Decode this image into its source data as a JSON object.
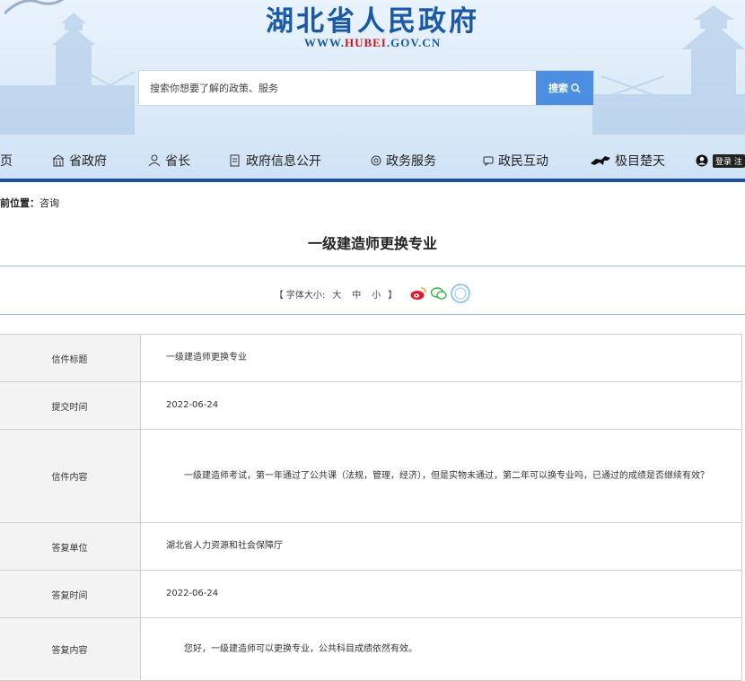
{
  "header": {
    "site_title": "湖北省人民政府",
    "site_url_prefix": "WWW.",
    "site_url_highlight": "HUBEI",
    "site_url_suffix": ".GOV.CN"
  },
  "search": {
    "placeholder": "搜索你想要了解的政策、服务",
    "button_label": "搜索"
  },
  "nav": {
    "items": [
      {
        "label": "页",
        "icon": "home-icon"
      },
      {
        "label": "省政府",
        "icon": "building-icon"
      },
      {
        "label": "省长",
        "icon": "person-icon"
      },
      {
        "label": "政府信息公开",
        "icon": "document-icon"
      },
      {
        "label": "政务服务",
        "icon": "service-icon"
      },
      {
        "label": "政民互动",
        "icon": "chat-icon"
      },
      {
        "label": "极目楚天",
        "icon": "horse-icon"
      }
    ],
    "login_label": "登录 注"
  },
  "breadcrumb": {
    "prefix": "前位置：",
    "current": "咨询"
  },
  "article": {
    "title": "一级建造师更换专业",
    "font_size_label": "【 字体大小:",
    "size_large": "大",
    "size_medium": "中",
    "size_small": "小",
    "font_size_end": "】"
  },
  "letter": {
    "rows": [
      {
        "label": "信件标题",
        "value": "一级建造师更换专业"
      },
      {
        "label": "提交时间",
        "value": "2022-06-24"
      },
      {
        "label": "信件内容",
        "value": "一级建造师考试，第一年通过了公共课（法规，管理，经济），但是实物未通过，第二年可以换专业吗，已通过的成绩是否继续有效？"
      },
      {
        "label": "答复单位",
        "value": "湖北省人力资源和社会保障厅"
      },
      {
        "label": "答复时间",
        "value": "2022-06-24"
      },
      {
        "label": "答复内容",
        "value": "您好，一级建造师可以更换专业，公共科目成绩依然有效。"
      }
    ]
  },
  "colors": {
    "brand_blue": "#1a59a8",
    "nav_underline": "#1e4f9e",
    "search_button": "#4c8fe0",
    "url_highlight": "#c8161d"
  }
}
